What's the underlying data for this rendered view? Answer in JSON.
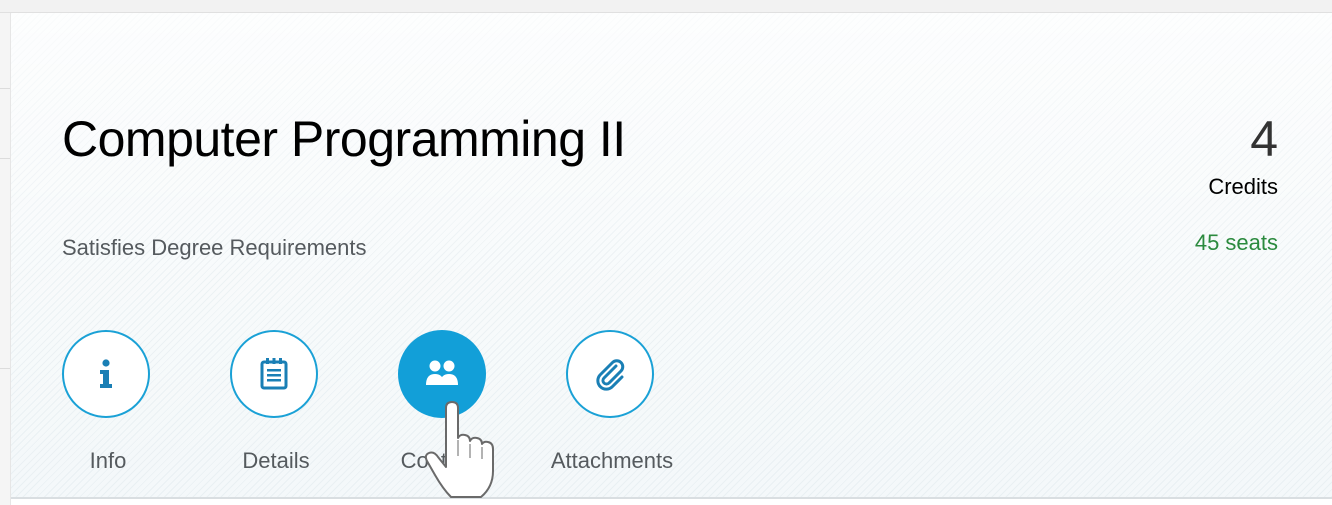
{
  "course": {
    "title": "Computer Programming II",
    "subtitle": "Satisfies Degree Requirements",
    "credits_value": "4",
    "credits_label": "Credits",
    "seats": "45 seats"
  },
  "tabs": [
    {
      "label": "Info",
      "icon": "info-icon",
      "selected": false
    },
    {
      "label": "Details",
      "icon": "details-icon",
      "selected": false
    },
    {
      "label": "Contacts",
      "icon": "contacts-icon",
      "selected": true
    },
    {
      "label": "Attachments",
      "icon": "paperclip-icon",
      "selected": false
    }
  ],
  "colors": {
    "accent": "#129fd8",
    "seats": "#2b8a3e",
    "text_secondary": "#555a5e"
  }
}
